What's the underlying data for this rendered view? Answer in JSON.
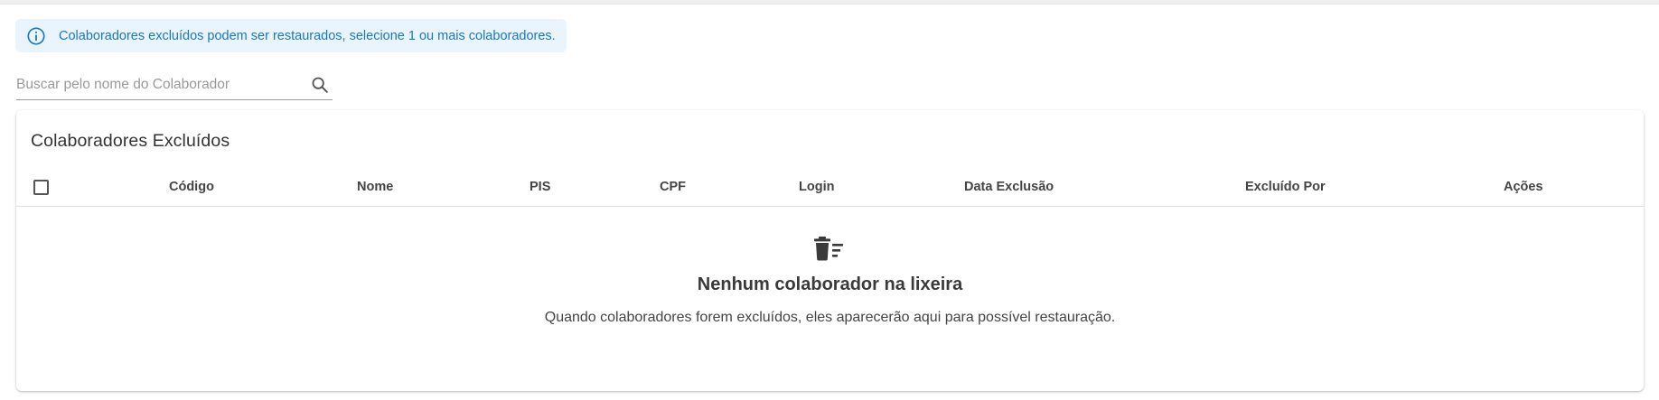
{
  "alert": {
    "message": "Colaboradores excluídos podem ser restaurados, selecione 1 ou mais colaboradores.",
    "icon": "info-icon",
    "color": "#1a78c2",
    "background": "#e9f4fd"
  },
  "search": {
    "placeholder": "Buscar pelo nome do Colaborador",
    "value": "",
    "icon": "search-icon"
  },
  "table": {
    "title": "Colaboradores Excluídos",
    "columns": [
      "Código",
      "Nome",
      "PIS",
      "CPF",
      "Login",
      "Data Exclusão",
      "Excluído Por",
      "Ações"
    ],
    "rows": []
  },
  "empty_state": {
    "icon": "trash-list-icon",
    "title": "Nenhum colaborador na lixeira",
    "subtitle": "Quando colaboradores forem excluídos, eles aparecerão aqui para possível restauração."
  }
}
